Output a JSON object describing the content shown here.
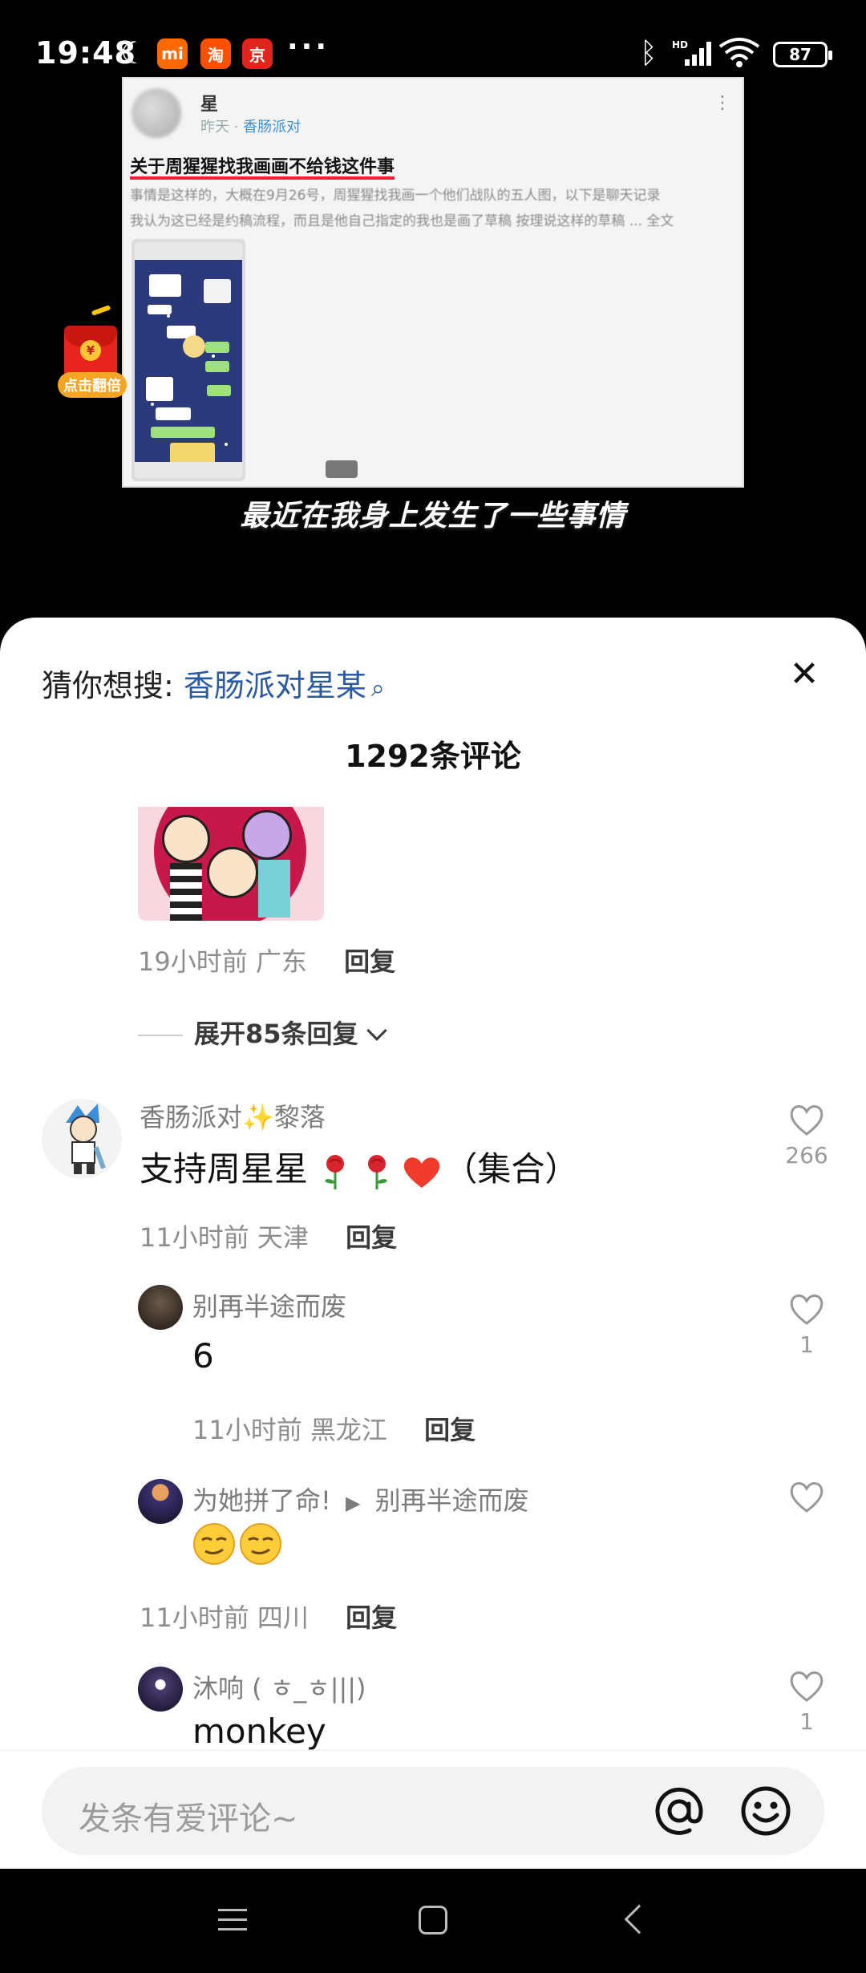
{
  "status_bar": {
    "time": "19:48",
    "app_icons": [
      {
        "glyph": "mi",
        "color": "#ff6900"
      },
      {
        "glyph": "淘",
        "color": "#ff5000"
      },
      {
        "glyph": "京",
        "color": "#e1251b"
      }
    ],
    "more": "···",
    "network": "HD",
    "battery": "87"
  },
  "video": {
    "post": {
      "author": "星",
      "meta_prefix": "昨天 · ",
      "meta_tag": "香肠派对",
      "title": "关于周猩猩找我画画不给钱这件事",
      "body_line1": "事情是这样的，大概在9月26号，周猩猩找我画一个他们战队的五人图，以下是聊天记录",
      "body_line2": "我认为这已经是约稿流程，而且是他自己指定的我也是画了草稿 按理说这样的草稿 ... 全文"
    },
    "caption": "最近在我身上发生了一些事情",
    "red_packet_label": "点击翻倍"
  },
  "comments_panel": {
    "suggest_prefix": "猜你想搜: ",
    "suggest_term": "香肠派对星某",
    "title": "1292条评论",
    "first_comment_meta": {
      "time": "19小时前",
      "location": "广东",
      "reply": "回复"
    },
    "expand_label": "展开85条回复",
    "comments": [
      {
        "user": "香肠派对✨黎落",
        "text": "支持周星星",
        "text_suffix": "（集合）",
        "time": "11小时前",
        "location": "天津",
        "reply": "回复",
        "likes": "266"
      },
      {
        "user": "别再半途而废",
        "text": "6",
        "time": "11小时前",
        "location": "黑龙江",
        "reply": "回复",
        "likes": "1"
      },
      {
        "user": "为她拼了命!",
        "reply_to": "别再半途而废",
        "time": "11小时前",
        "location": "四川",
        "reply": "回复",
        "likes": ""
      },
      {
        "user": "沐响 ( ㅎ_ㅎ|||)",
        "text": "monkey",
        "likes": "1"
      }
    ],
    "input_placeholder": "发条有爱评论~"
  },
  "colors": {
    "link": "#2a5aa3",
    "red_underline": "#e22233",
    "rose": "#d8242c",
    "heart": "#ef3b2c"
  }
}
